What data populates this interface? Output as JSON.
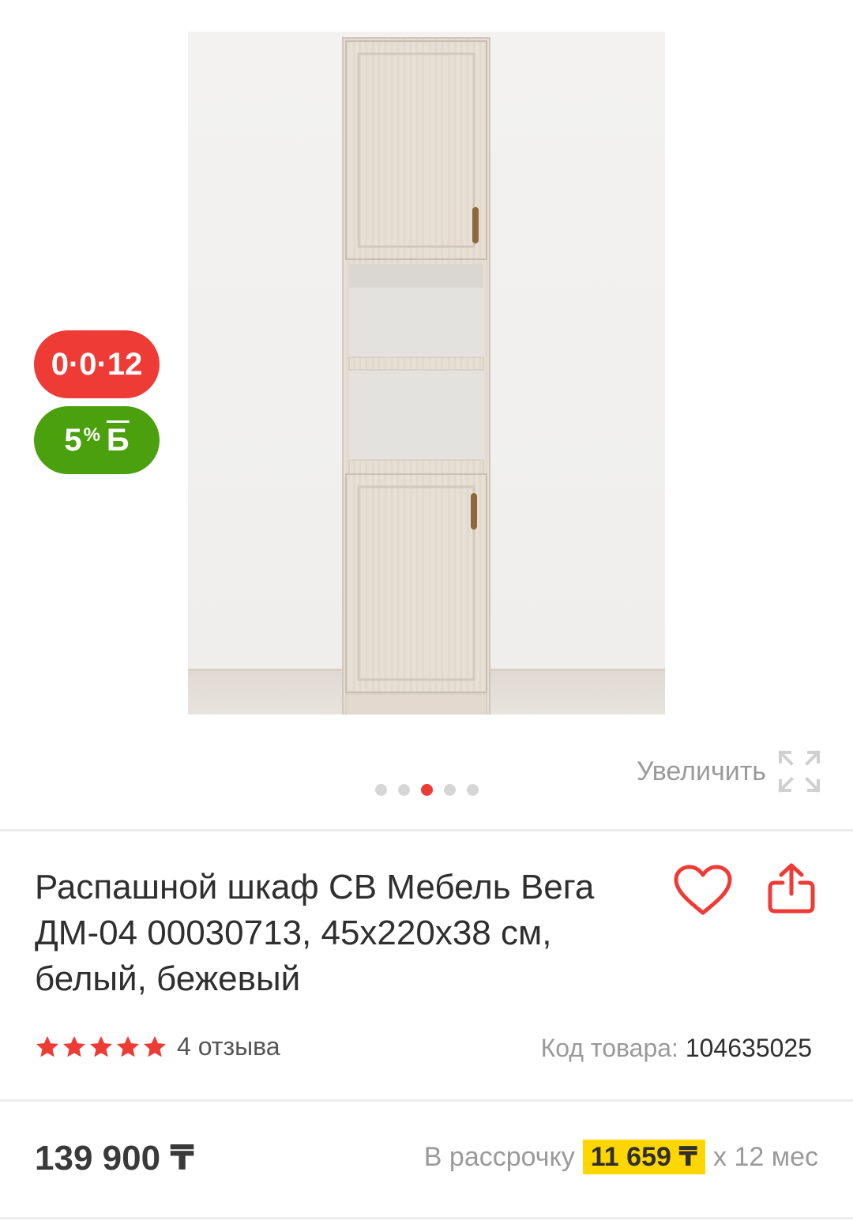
{
  "badges": {
    "installment": "0·0·12",
    "bonus_percent": "5",
    "bonus_percent_sign": "%",
    "bonus_currency": "Б"
  },
  "gallery": {
    "zoom_label": "Увеличить",
    "slide_count": 5,
    "active_slide": 3
  },
  "product": {
    "title": "Распашной шкаф СВ Мебель Вега ДМ-04 00030713, 45x220x38 см, белый, бежевый",
    "rating_stars": 5,
    "reviews_label": "4 отзыва",
    "sku_label": "Код товара:",
    "sku_value": "104635025"
  },
  "pricing": {
    "price": "139 900 ₸",
    "installment_prefix": "В рассрочку",
    "installment_amount": "11 659 ₸",
    "installment_suffix": "x 12 мес"
  },
  "colors": {
    "accent_red": "#ef3b36",
    "bonus_green": "#4aa00d",
    "installment_yellow": "#ffd600"
  },
  "icons": {
    "favorite": "heart-icon",
    "share": "share-icon",
    "zoom": "expand-icon",
    "rating": "star-icon"
  }
}
